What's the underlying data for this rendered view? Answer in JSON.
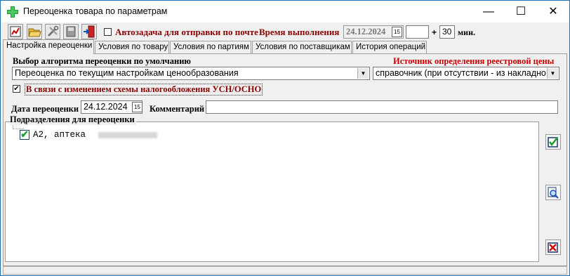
{
  "window": {
    "title": "Переоценка товара по параметрам",
    "controls": {
      "minimize": "—",
      "maximize": "☐",
      "close": "✕"
    }
  },
  "toolbar": {
    "autotask_label": "Автозадача для отправки по почте",
    "autotask_checked": false,
    "exec_time_label": "Время выполнения",
    "exec_date": "24.12.2024",
    "plus_label": "+",
    "minutes_value": "30",
    "minutes_unit": "мин."
  },
  "tabs": [
    {
      "label": "Настройка переоценки",
      "active": true
    },
    {
      "label": "Условия по товару"
    },
    {
      "label": "Условия по партиям"
    },
    {
      "label": "Условия по поставщикам"
    },
    {
      "label": "История операций"
    }
  ],
  "settings": {
    "algorithm_label": "Выбор алгоритма переоценки по умолчанию",
    "algorithm_value": "Переоценка по текущим настройкам ценообразования",
    "source_label": "Источник определения реестровой цены",
    "source_value": "справочник (при отсутствии - из накладно",
    "tax_change_label": "В связи с изменением схемы налогообложения УСН/ОСНО",
    "tax_change_checked": true,
    "date_label": "Дата переоценки",
    "date_value": "24.12.2024",
    "comment_label": "Комментарий",
    "comment_value": "",
    "departments_label": "Подразделения для переоценки",
    "departments": [
      {
        "name": "А2, аптека",
        "checked": true
      }
    ]
  },
  "colors": {
    "accent_dark_red": "#8b0000",
    "source_label_red": "#cc0000"
  }
}
